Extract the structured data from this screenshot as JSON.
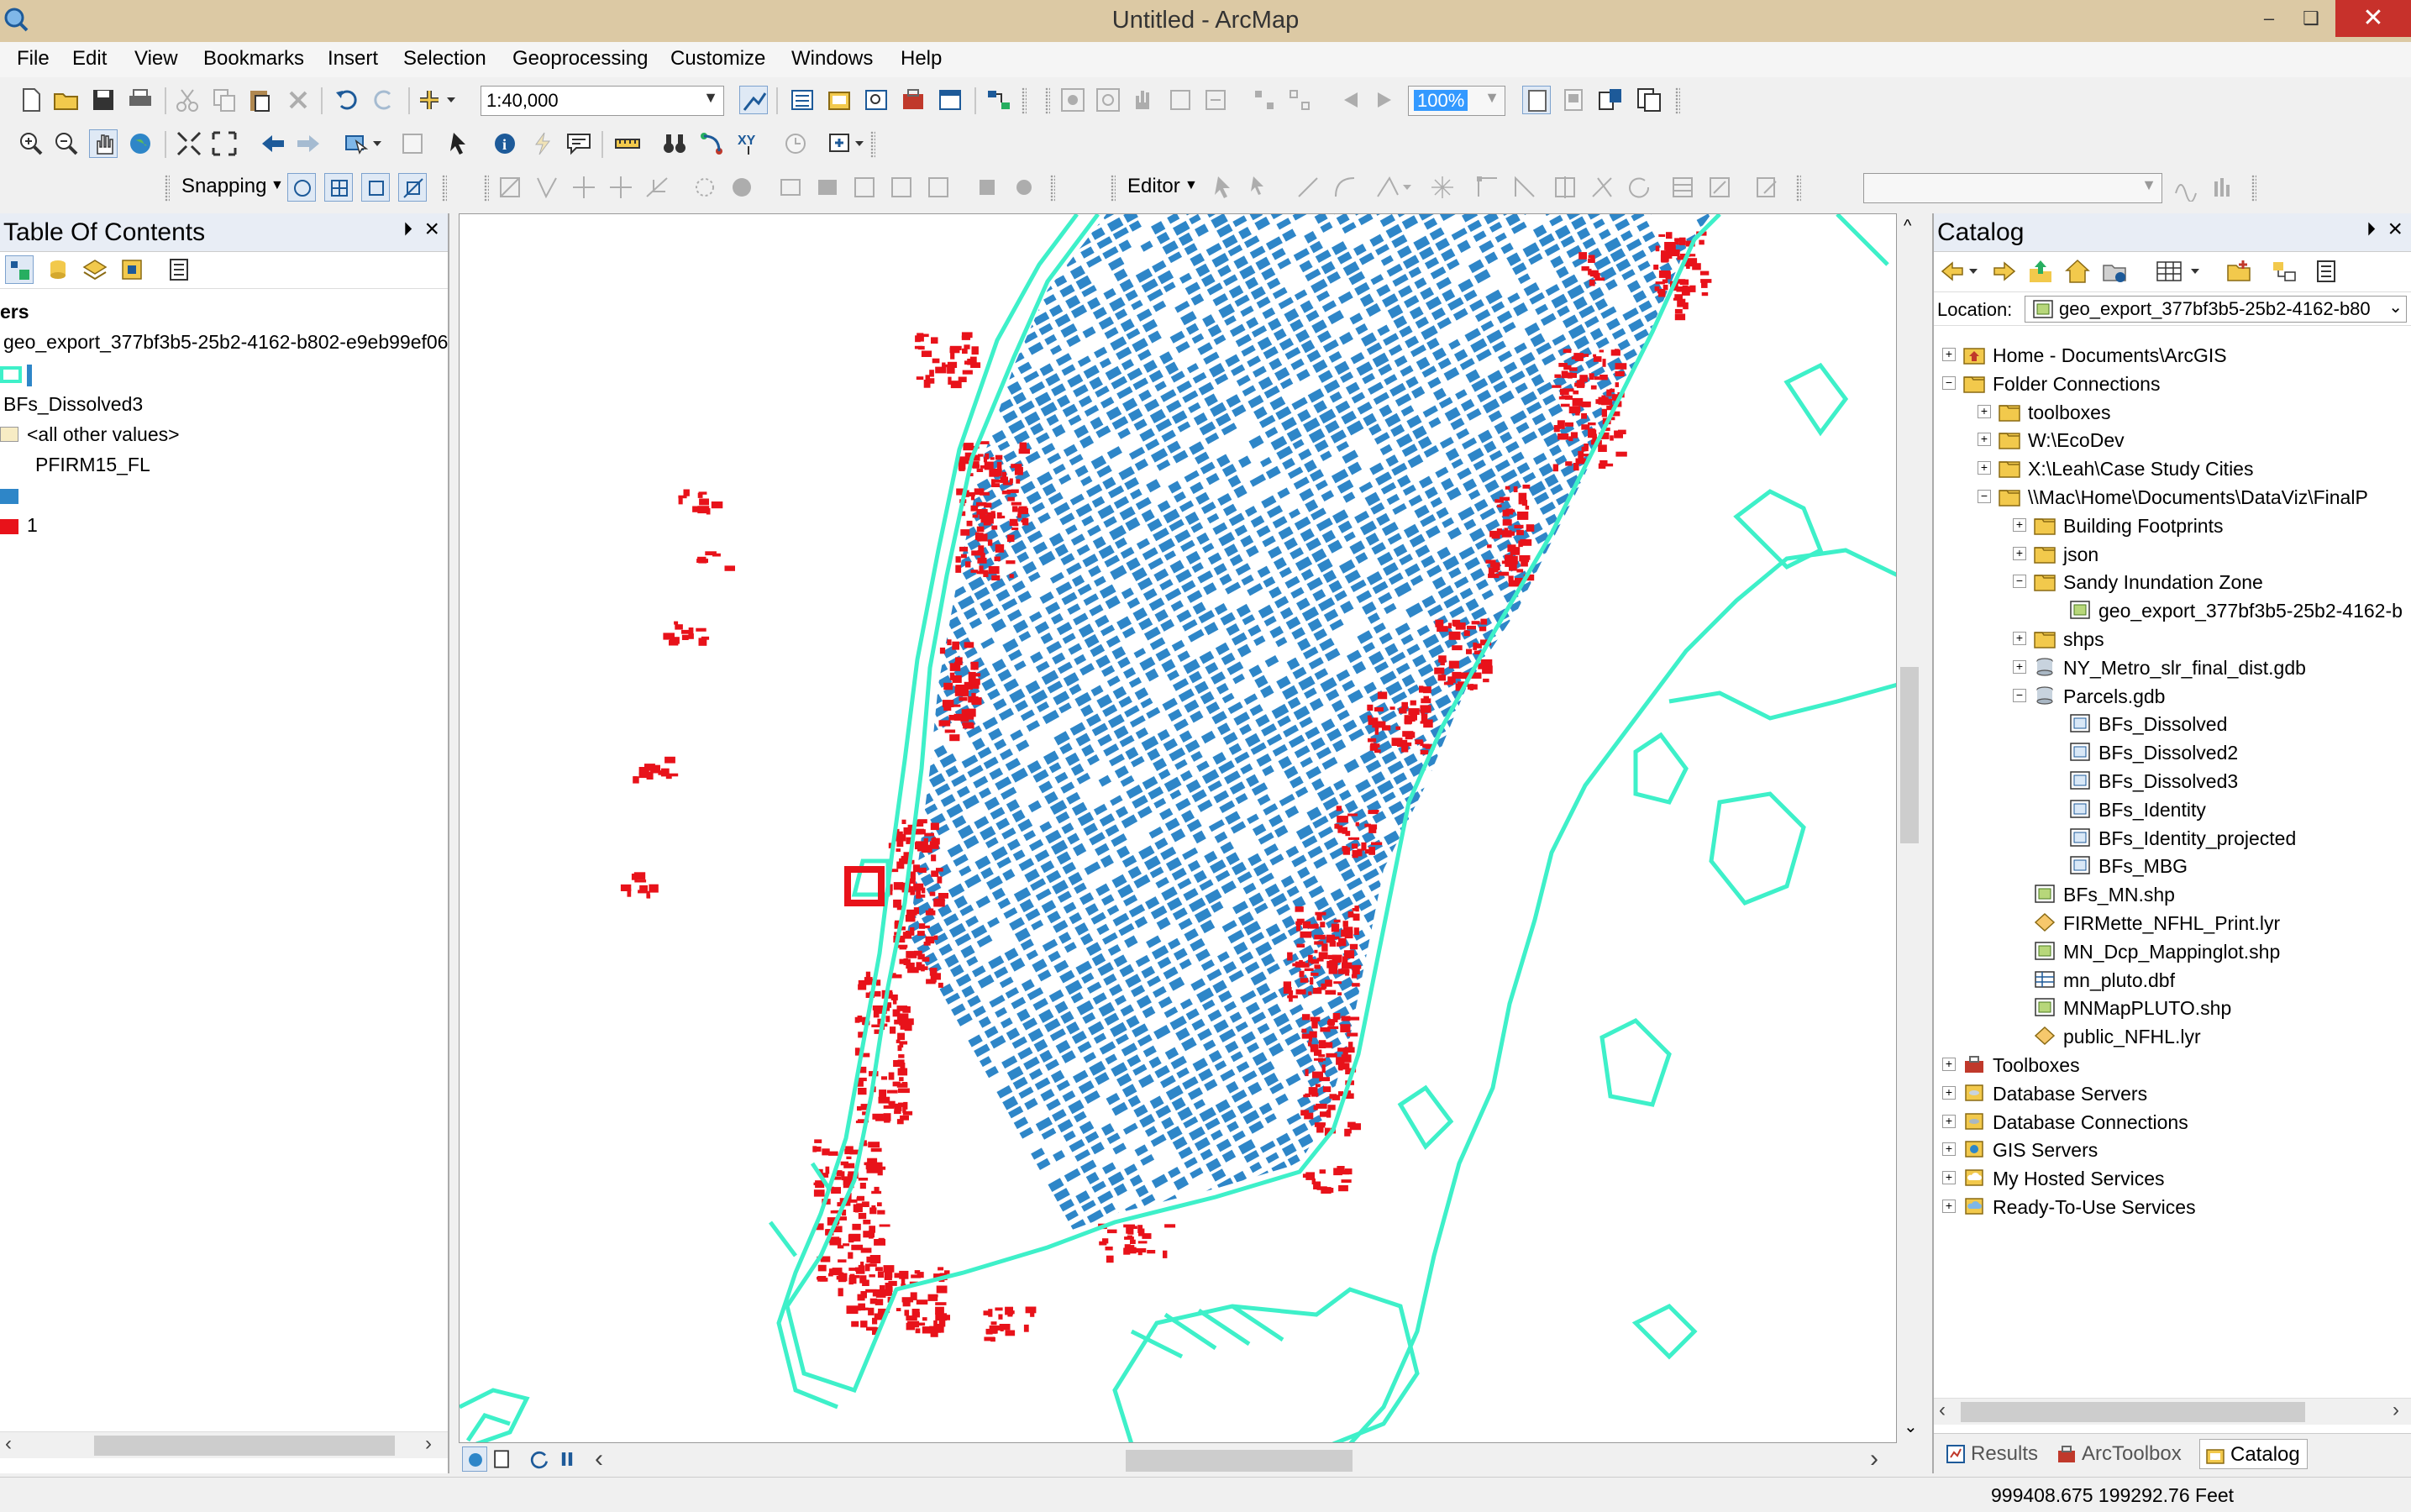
{
  "window": {
    "title": "Untitled - ArcMap"
  },
  "menu": [
    "File",
    "Edit",
    "View",
    "Bookmarks",
    "Insert",
    "Selection",
    "Geoprocessing",
    "Customize",
    "Windows",
    "Help"
  ],
  "toolbar": {
    "scale": "1:40,000",
    "zoom_percent": "100%",
    "snapping_label": "Snapping",
    "editor_label": "Editor"
  },
  "toc": {
    "title": "Table Of Contents",
    "layers_label": "ers",
    "layer1": "geo_export_377bf3b5-25b2-4162-b802-e9eb99ef06",
    "layer2": "BFs_Dissolved3",
    "all_other_values": "<all other values>",
    "field": "PFIRM15_FL",
    "value1": "1"
  },
  "catalog": {
    "title": "Catalog",
    "location_label": "Location:",
    "location_value": "geo_export_377bf3b5-25b2-4162-b80",
    "tree": [
      {
        "label": "Home - Documents\\ArcGIS",
        "level": 0,
        "exp": "+",
        "icon": "folder-home-icon"
      },
      {
        "label": "Folder Connections",
        "level": 0,
        "exp": "-",
        "icon": "folder-icon"
      },
      {
        "label": "toolboxes",
        "level": 1,
        "exp": "+",
        "icon": "folder-icon"
      },
      {
        "label": "W:\\EcoDev",
        "level": 1,
        "exp": "+",
        "icon": "folder-icon"
      },
      {
        "label": "X:\\Leah\\Case Study Cities",
        "level": 1,
        "exp": "+",
        "icon": "folder-icon"
      },
      {
        "label": "\\\\Mac\\Home\\Documents\\DataViz\\FinalP",
        "level": 1,
        "exp": "-",
        "icon": "folder-icon"
      },
      {
        "label": "Building Footprints",
        "level": 2,
        "exp": "+",
        "icon": "folder-icon"
      },
      {
        "label": "json",
        "level": 2,
        "exp": "+",
        "icon": "folder-icon"
      },
      {
        "label": "Sandy Inundation Zone",
        "level": 2,
        "exp": "-",
        "icon": "folder-icon"
      },
      {
        "label": "geo_export_377bf3b5-25b2-4162-b",
        "level": 3,
        "exp": "",
        "icon": "shapefile-icon"
      },
      {
        "label": "shps",
        "level": 2,
        "exp": "+",
        "icon": "folder-icon"
      },
      {
        "label": "NY_Metro_slr_final_dist.gdb",
        "level": 2,
        "exp": "+",
        "icon": "geodatabase-icon"
      },
      {
        "label": "Parcels.gdb",
        "level": 2,
        "exp": "-",
        "icon": "geodatabase-icon"
      },
      {
        "label": "BFs_Dissolved",
        "level": 3,
        "exp": "",
        "icon": "feature-class-icon"
      },
      {
        "label": "BFs_Dissolved2",
        "level": 3,
        "exp": "",
        "icon": "feature-class-icon"
      },
      {
        "label": "BFs_Dissolved3",
        "level": 3,
        "exp": "",
        "icon": "feature-class-icon"
      },
      {
        "label": "BFs_Identity",
        "level": 3,
        "exp": "",
        "icon": "feature-class-icon"
      },
      {
        "label": "BFs_Identity_projected",
        "level": 3,
        "exp": "",
        "icon": "feature-class-icon"
      },
      {
        "label": "BFs_MBG",
        "level": 3,
        "exp": "",
        "icon": "feature-class-icon"
      },
      {
        "label": "BFs_MN.shp",
        "level": 2,
        "exp": "",
        "icon": "shapefile-icon"
      },
      {
        "label": "FIRMette_NFHL_Print.lyr",
        "level": 2,
        "exp": "",
        "icon": "layer-file-icon"
      },
      {
        "label": "MN_Dcp_Mappinglot.shp",
        "level": 2,
        "exp": "",
        "icon": "shapefile-icon"
      },
      {
        "label": "mn_pluto.dbf",
        "level": 2,
        "exp": "",
        "icon": "table-icon"
      },
      {
        "label": "MNMapPLUTO.shp",
        "level": 2,
        "exp": "",
        "icon": "shapefile-icon"
      },
      {
        "label": "public_NFHL.lyr",
        "level": 2,
        "exp": "",
        "icon": "layer-file-icon"
      },
      {
        "label": "Toolboxes",
        "level": 0,
        "exp": "+",
        "icon": "toolbox-icon"
      },
      {
        "label": "Database Servers",
        "level": 0,
        "exp": "+",
        "icon": "database-server-icon"
      },
      {
        "label": "Database Connections",
        "level": 0,
        "exp": "+",
        "icon": "database-connection-icon"
      },
      {
        "label": "GIS Servers",
        "level": 0,
        "exp": "+",
        "icon": "gis-server-icon"
      },
      {
        "label": "My Hosted Services",
        "level": 0,
        "exp": "+",
        "icon": "hosted-services-icon"
      },
      {
        "label": "Ready-To-Use Services",
        "level": 0,
        "exp": "+",
        "icon": "ready-services-icon"
      }
    ],
    "tabs": [
      "Results",
      "ArcToolbox",
      "Catalog"
    ]
  },
  "status": {
    "coordinates": "999408.675  199292.76 Feet"
  },
  "colors": {
    "water_outline": "#3ef0c9",
    "buildings": "#2e86c8",
    "flood": "#e8121a",
    "title_bar": "#dcc9a4"
  }
}
